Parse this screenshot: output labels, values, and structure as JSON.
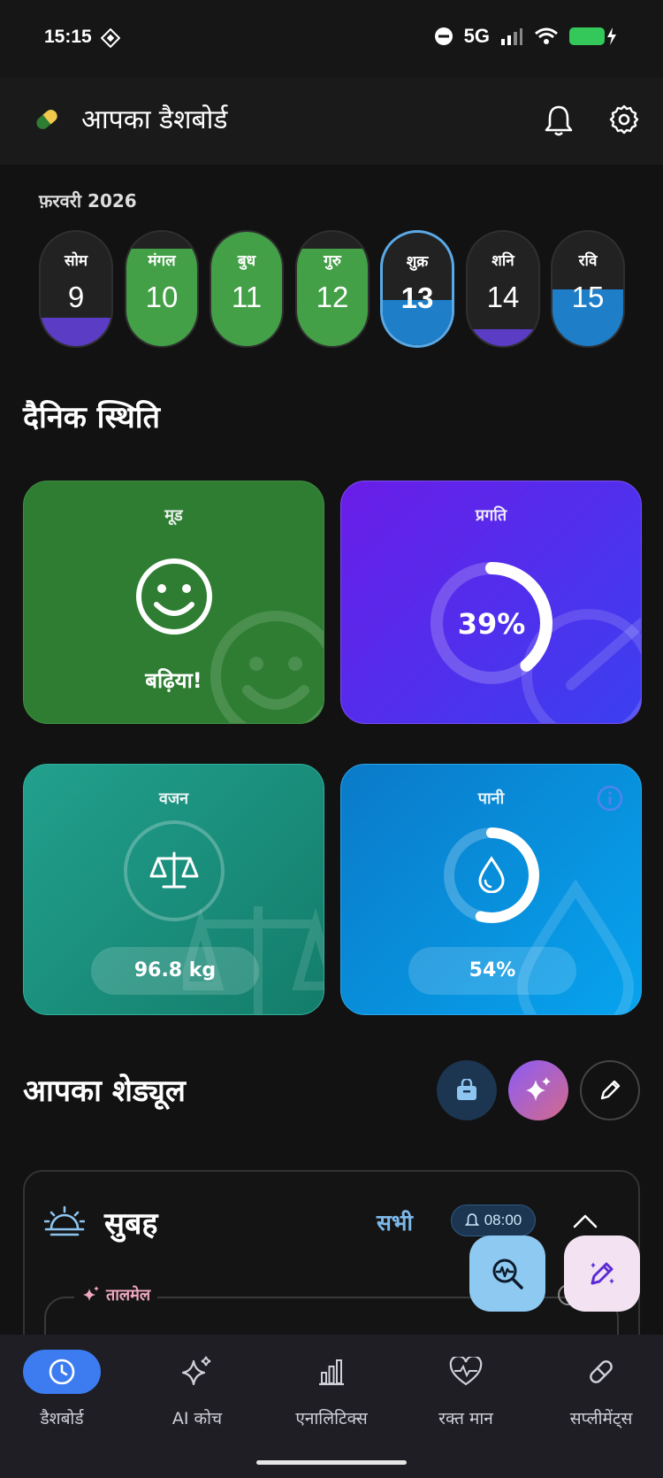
{
  "status": {
    "time": "15:15",
    "network": "5G"
  },
  "header": {
    "title": "आपका डैशबोर्ड"
  },
  "calendar": {
    "month": "फ़रवरी 2026",
    "days": [
      {
        "name": "सोम",
        "num": "9",
        "fill": 0.25,
        "color": "#5b3cc4"
      },
      {
        "name": "मंगल",
        "num": "10",
        "fill": 0.85,
        "color": "#43a047"
      },
      {
        "name": "बुध",
        "num": "11",
        "fill": 1.0,
        "color": "#43a047"
      },
      {
        "name": "गुरु",
        "num": "12",
        "fill": 0.85,
        "color": "#43a047"
      },
      {
        "name": "शुक्र",
        "num": "13",
        "fill": 0.4,
        "color": "#1e7ec8"
      },
      {
        "name": "शनि",
        "num": "14",
        "fill": 0.15,
        "color": "#5b3cc4"
      },
      {
        "name": "रवि",
        "num": "15",
        "fill": 0.5,
        "color": "#1e7ec8"
      }
    ]
  },
  "daily": {
    "title": "दैनिक स्थिति",
    "mood": {
      "title": "मूड",
      "value": "बढ़िया!"
    },
    "progress": {
      "title": "प्रगति",
      "value": "39%",
      "percent": 39
    },
    "weight": {
      "title": "वजन",
      "value": "96.8 kg"
    },
    "water": {
      "title": "पानी",
      "value": "54%",
      "percent": 54
    }
  },
  "schedule": {
    "title": "आपका शेड्यूल",
    "period": "सुबह",
    "filter": "सभी",
    "reminder_time": "08:00",
    "group_label": "तालमेल"
  },
  "nav": {
    "items": [
      {
        "label": "डैशबोर्ड"
      },
      {
        "label": "AI कोच"
      },
      {
        "label": "एनालिटिक्स"
      },
      {
        "label": "रक्त मान"
      },
      {
        "label": "सप्लीमेंट्स"
      }
    ]
  }
}
